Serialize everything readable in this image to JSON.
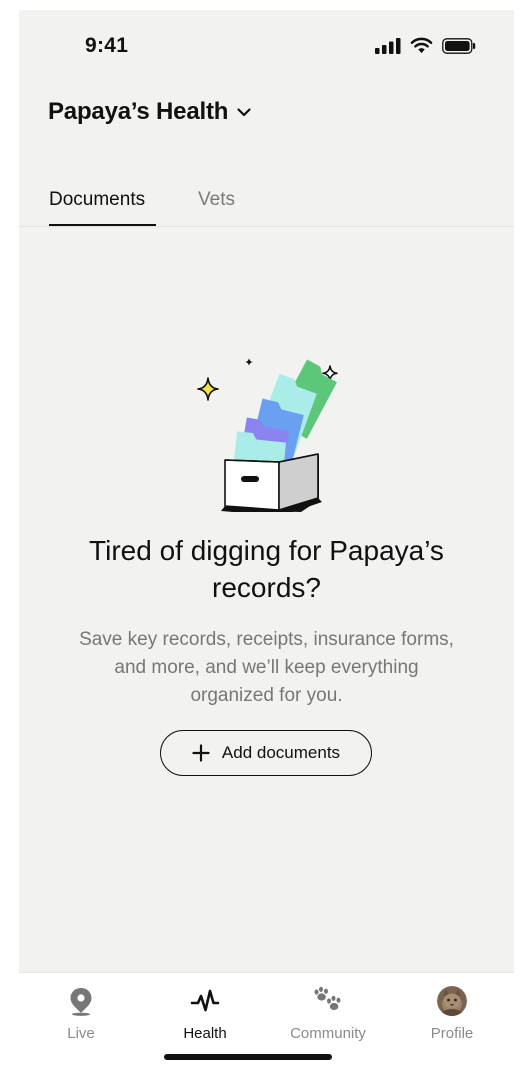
{
  "status_bar": {
    "time": "9:41"
  },
  "header": {
    "title": "Papaya’s Health"
  },
  "tabs": [
    {
      "label": "Documents",
      "active": true
    },
    {
      "label": "Vets",
      "active": false
    }
  ],
  "empty_state": {
    "title_line1": "Tired of digging for Papaya’s",
    "title_line2": "records?",
    "description_line1": "Save key records, receipts, insurance forms,",
    "description_line2": "and more, and we’ll keep everything",
    "description_line3": "organized for you.",
    "button_label": "Add documents"
  },
  "bottom_nav": [
    {
      "label": "Live",
      "icon": "location-pin-icon",
      "active": false
    },
    {
      "label": "Health",
      "icon": "heartbeat-icon",
      "active": true
    },
    {
      "label": "Community",
      "icon": "paw-prints-icon",
      "active": false
    },
    {
      "label": "Profile",
      "icon": "avatar",
      "active": false
    }
  ],
  "colors": {
    "background": "#f2f2f0",
    "text": "#111111",
    "muted_text": "#777777",
    "folder_green": "#5cc77a",
    "folder_cyan": "#a9ece8",
    "folder_blue": "#6aa0f0",
    "folder_purple": "#8b83f0",
    "sparkle_yellow": "#f5e14a"
  }
}
